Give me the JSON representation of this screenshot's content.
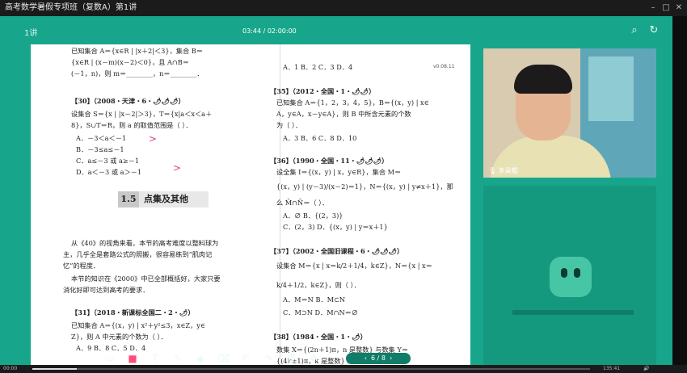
{
  "window": {
    "title": "高考数学暑假专项班（复数A）第1讲"
  },
  "topbar": {
    "lesson_tag": "1讲",
    "time_current": "03:44",
    "time_total": "02:00:00",
    "time_separator": " / "
  },
  "document": {
    "left_column": [
      "已知集合 A＝{x∈R | |x＋2|＜3}，集合 B＝",
      "{x∈R | (x－m)(x－2)＜0}，且 A∩B＝",
      "(－1，n)，则 m＝________，n＝________．",
      "【30】（2008・天津・6・🌶🌶🌶）",
      "设集合 S＝{x | |x－2|＞3}，T＝{x|a＜x＜a＋",
      "8}，S∪T＝R，则 a 的取值范围是（    ）．",
      "A．－3＜a＜－1",
      "B．－3≤a≤－1",
      "C．a≤－3 或 a≥－1",
      "D．a＜－3 或 a＞－1",
      "从《40》的视角来看，本节的高考难度以整料球为",
      "主，几乎全是套路公式的照搬，很容易练到“肌肉记",
      "忆”的程度．",
      "本节的知识在《2000》中已全部概括好，大家只要",
      "消化好即可达到高考的要求．",
      "【31】（2018・新课标全国二・2・🌶）",
      "已知集合 A＝{(x，y) | x²＋y²≤3，x∈Z，y∈",
      "Z}，则 A 中元素的个数为（    ）．",
      "A．9          B．8          C．5          D．4"
    ],
    "section": {
      "number": "1.5",
      "title": "点集及其他"
    },
    "right_column": [
      "A．1          B．2          C．3          D．4",
      "【35】（2012・全国・1・🌶🌶）",
      "已知集合 A＝{1，2，3，4，5}，B＝{(x，y) | x∈",
      "A，y∈A，x－y∈A}，则 B 中所含元素的个数",
      "为（    ）．",
      "A．3          B．6          C．8          D．10",
      "【36】（1990・全国・11・🌶🌶🌶）",
      "设全集 I＝{(x，y) | x，y∈R}，集合 M＝",
      "{(x，y) | (y－3)/(x－2)＝1}，N＝{(x，y) | y≠x＋1}，那",
      "么 M̄∩N̄＝（    ）．",
      "A．∅                      B．{(2，3)}",
      "C．(2，3)                  D．{(x，y) | y＝x＋1}",
      "【37】（2002・全国旧课程・6・🌶🌶🌶）",
      "设集合 M＝{x | x＝k/2＋1/4，k∈Z}，N＝{x | x＝",
      "k/4＋1/2，k∈Z}，则（    ）．",
      "A．M＝N                    B．M⊂N",
      "C．M⊃N                    D．M∩N＝∅",
      "【38】（1984・全国・1・🌶）",
      "数集 X＝{(2n＋1)π，n 是整数} 与数集 Y＝",
      "{(4k±1)π，k 是整数} 之间的关系是（    ）．"
    ],
    "watermark": "v0.08.11"
  },
  "toolbar": {
    "page_current": "6",
    "page_total": "8",
    "page_separator": " / ",
    "prev": "‹",
    "next": "›"
  },
  "camera": {
    "teacher_name": "朱昊鲲"
  },
  "player": {
    "elapsed": "00:00",
    "duration": "135:41",
    "progress": 0.08
  },
  "colors": {
    "stage": "#17a68b",
    "ink": "#e23a8f",
    "panel": "#14997f"
  }
}
